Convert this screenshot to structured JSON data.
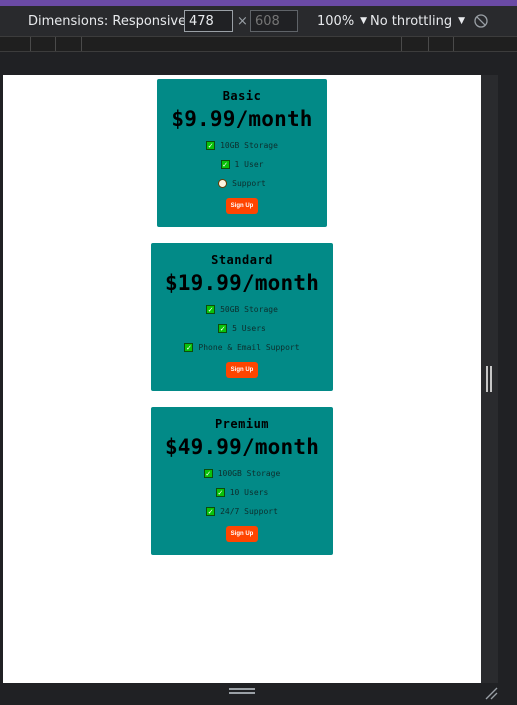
{
  "toolbar": {
    "dimensions_label": "Dimensions: Responsive",
    "width_value": "478",
    "height_value": "608",
    "times": "×",
    "zoom_label": "100%",
    "throttle_label": "No throttling"
  },
  "cards": [
    {
      "title": "Basic",
      "price": "$9.99/month",
      "features": [
        {
          "text": "10GB Storage",
          "included": true
        },
        {
          "text": "1 User",
          "included": true
        },
        {
          "text": "Support",
          "included": false
        }
      ],
      "button": "Sign Up"
    },
    {
      "title": "Standard",
      "price": "$19.99/month",
      "features": [
        {
          "text": "50GB Storage",
          "included": true
        },
        {
          "text": "5 Users",
          "included": true
        },
        {
          "text": "Phone & Email Support",
          "included": true
        }
      ],
      "button": "Sign Up"
    },
    {
      "title": "Premium",
      "price": "$49.99/month",
      "features": [
        {
          "text": "100GB Storage",
          "included": true
        },
        {
          "text": "10 Users",
          "included": true
        },
        {
          "text": "24/7 Support",
          "included": true
        }
      ],
      "button": "Sign Up"
    }
  ],
  "colors": {
    "card_background": "#028a87",
    "button_background": "#ff4500",
    "check_green": "#0ac20a",
    "devtools_bg": "#202124",
    "accent_bar": "#6a4aa5"
  },
  "icons": {
    "rotate": "rotate-icon",
    "check": "checkbox-checked-icon",
    "unavailable": "circle-icon"
  }
}
